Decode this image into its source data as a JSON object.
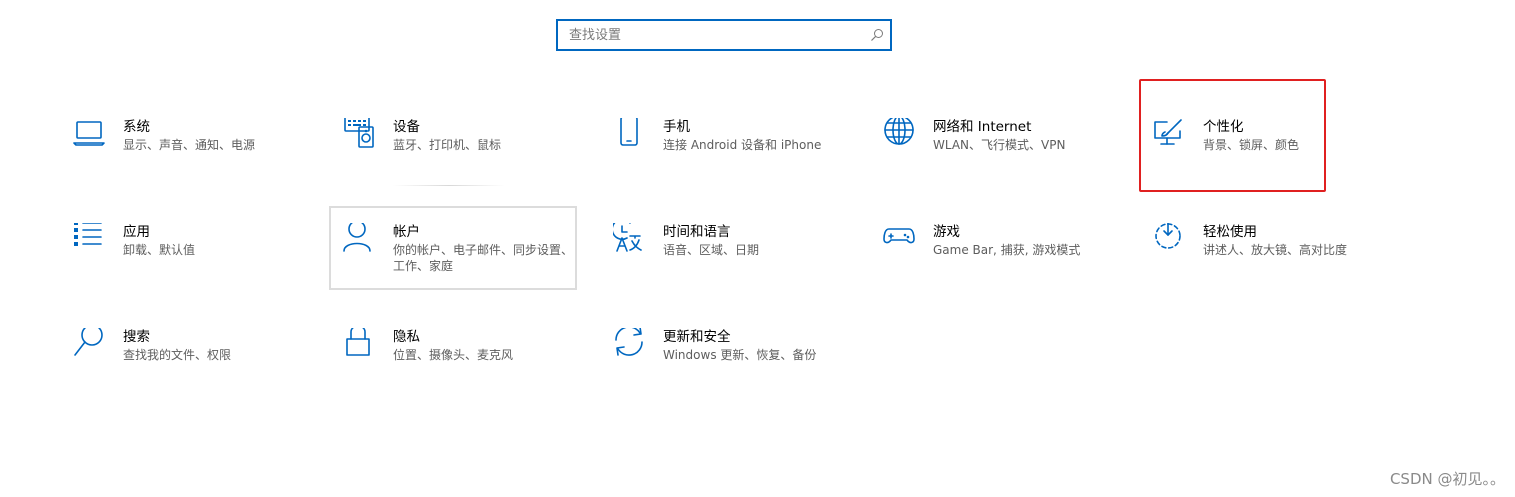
{
  "search": {
    "placeholder": "查找设置",
    "value": ""
  },
  "tiles": [
    {
      "title": "系统",
      "desc": "显示、声音、通知、电源",
      "icon": "laptop-icon"
    },
    {
      "title": "设备",
      "desc": "蓝牙、打印机、鼠标",
      "icon": "keyboard-speaker-icon"
    },
    {
      "title": "手机",
      "desc": "连接 Android 设备和 iPhone",
      "icon": "phone-icon"
    },
    {
      "title": "网络和 Internet",
      "desc": "WLAN、飞行模式、VPN",
      "icon": "globe-icon"
    },
    {
      "title": "个性化",
      "desc": "背景、锁屏、颜色",
      "icon": "monitor-brush-icon"
    },
    {
      "title": "应用",
      "desc": "卸载、默认值",
      "icon": "app-list-icon"
    },
    {
      "title": "帐户",
      "desc": "你的帐户、电子邮件、同步设置、工作、家庭",
      "icon": "person-icon"
    },
    {
      "title": "时间和语言",
      "desc": "语音、区域、日期",
      "icon": "clock-language-icon"
    },
    {
      "title": "游戏",
      "desc": "Game Bar, 捕获, 游戏模式",
      "icon": "gamepad-icon"
    },
    {
      "title": "轻松使用",
      "desc": "讲述人、放大镜、高对比度",
      "icon": "ease-of-access-icon"
    },
    {
      "title": "搜索",
      "desc": "查找我的文件、权限",
      "icon": "search-magnifier-icon"
    },
    {
      "title": "隐私",
      "desc": "位置、摄像头、麦克风",
      "icon": "lock-icon"
    },
    {
      "title": "更新和安全",
      "desc": "Windows 更新、恢复、备份",
      "icon": "sync-arrows-icon"
    }
  ],
  "highlight": {
    "color": "#e02020",
    "target": "个性化"
  },
  "accent": "#0067c0",
  "watermark": "CSDN @初见。。"
}
